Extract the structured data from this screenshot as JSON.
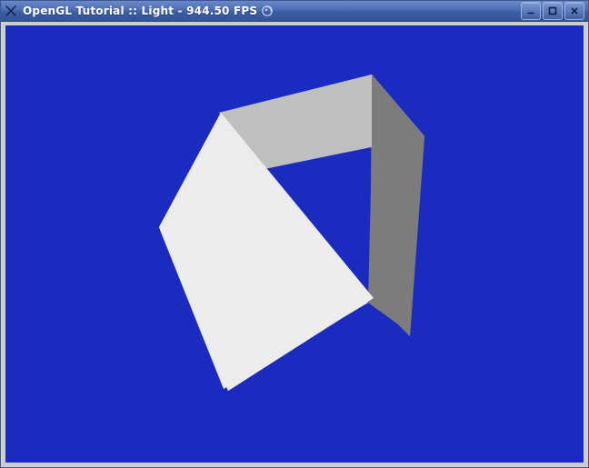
{
  "window": {
    "icon": "app-x-icon",
    "title": "OpenGL Tutorial :: Light - 944.50 FPS",
    "ornament_icon": "gecko-swirl-icon",
    "minimize_name": "minimize-icon",
    "maximize_name": "maximize-icon",
    "close_name": "close-icon"
  },
  "scene": {
    "background_color": "#1b2abf",
    "object": "lit-cube",
    "fps": 944.5,
    "tutorial": "Light",
    "series": "OpenGL Tutorial"
  },
  "cube_faces": {
    "front_color": "#ececec",
    "top_color": "#bfbfbf",
    "side_color": "#7c7c7c"
  }
}
